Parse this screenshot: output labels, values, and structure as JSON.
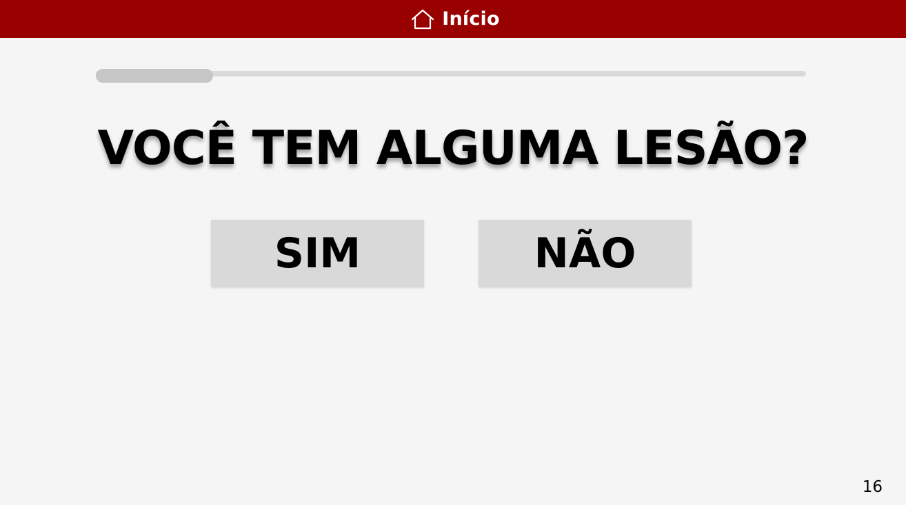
{
  "header": {
    "home_label": "Início",
    "home_icon": "home-icon",
    "background_color": "#990000"
  },
  "progress": {
    "fraction": 0.165
  },
  "question": {
    "text": "VOCÊ TEM ALGUMA LESÃO?"
  },
  "answers": {
    "yes_label": "SIM",
    "no_label": "NÃO"
  },
  "footer": {
    "page_number": "16"
  }
}
